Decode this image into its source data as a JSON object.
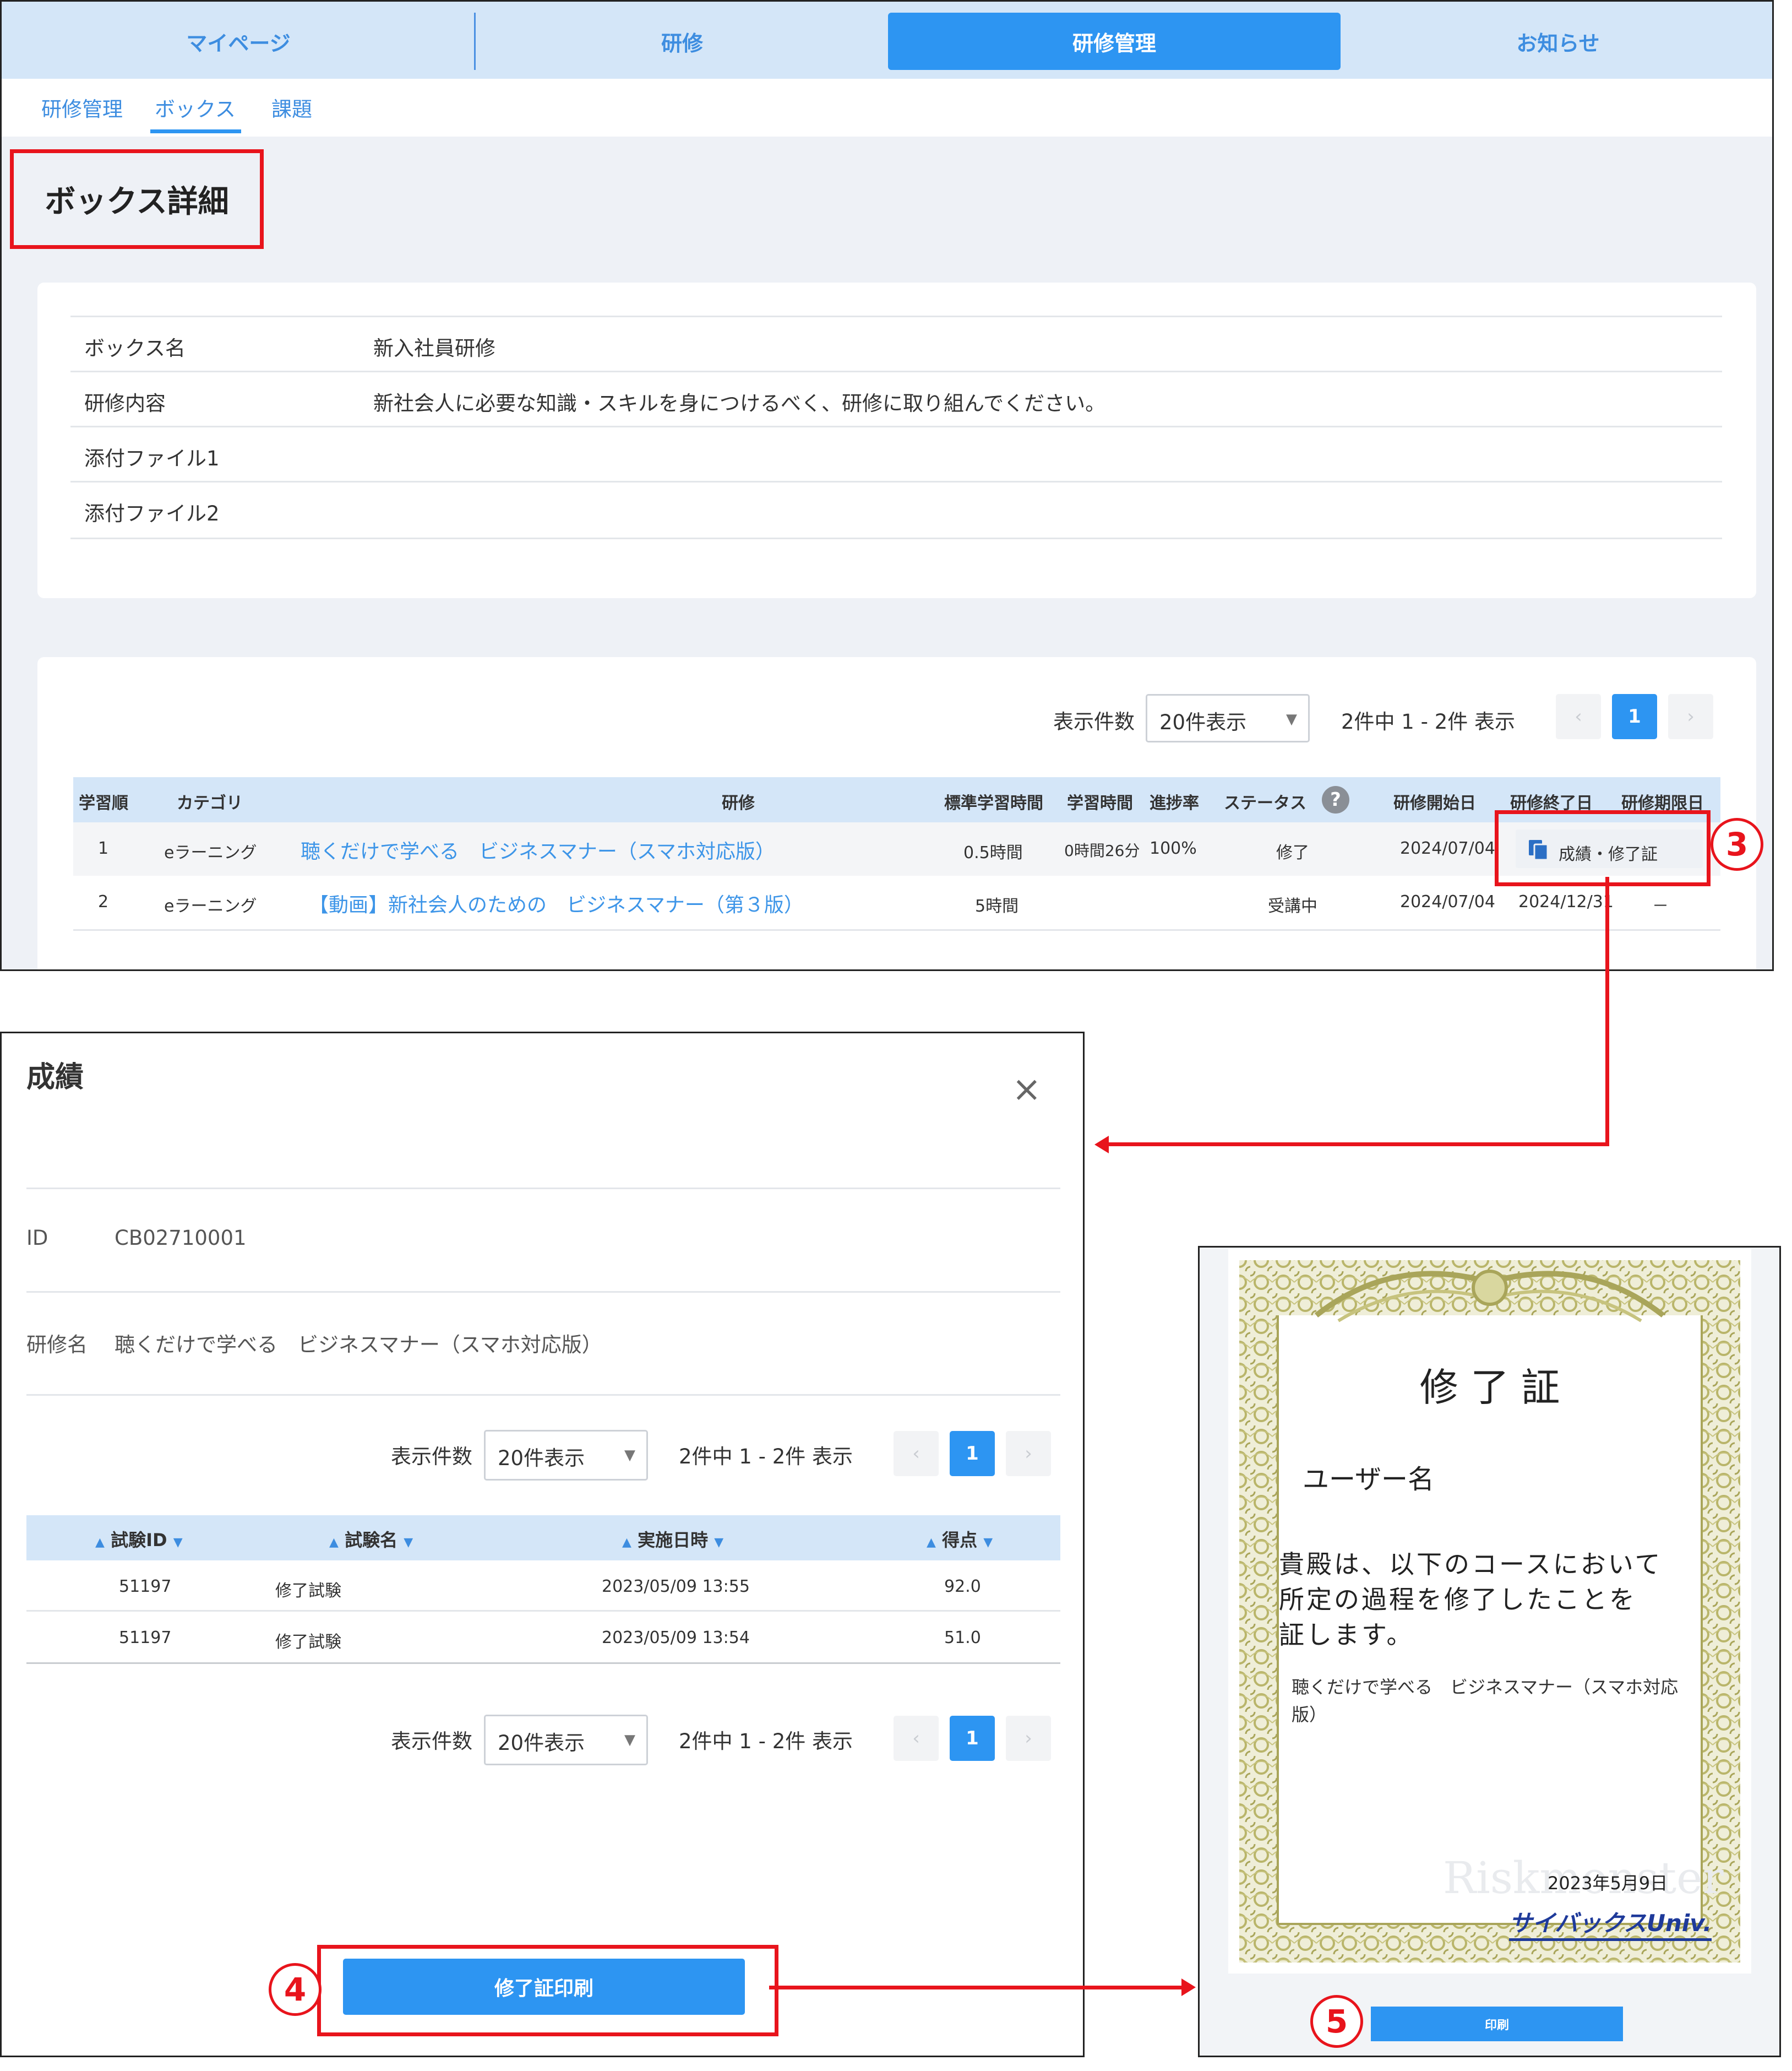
{
  "nav": {
    "items": [
      "マイページ",
      "研修",
      "研修管理",
      "お知らせ"
    ]
  },
  "subnav": {
    "items": [
      "研修管理",
      "ボックス",
      "課題"
    ]
  },
  "page": {
    "title": "ボックス詳細"
  },
  "details": [
    {
      "key": "ボックス名",
      "value": "新入社員研修"
    },
    {
      "key": "研修内容",
      "value": "新社会人に必要な知識・スキルを身につけるべく、研修に取り組んでください。"
    },
    {
      "key": "添付ファイル1",
      "value": ""
    },
    {
      "key": "添付ファイル2",
      "value": ""
    }
  ],
  "list": {
    "per_page_label": "表示件数",
    "per_page_value": "20件表示",
    "count_text": "2件中 1 - 2件 表示",
    "prev": "‹",
    "page": "1",
    "next": "›",
    "columns": [
      "学習順",
      "カテゴリ",
      "研修",
      "標準学習時間",
      "学習時間",
      "進捗率",
      "ステータス",
      "研修開始日",
      "研修終了日",
      "研修期限日"
    ],
    "help_icon": "?",
    "rows": [
      {
        "order": "1",
        "category": "eラーニング",
        "title": "聴くだけで学べる　ビジネスマナー（スマホ対応版）",
        "std_time": "0.5時間",
        "study_time": "0時間26分",
        "progress": "100%",
        "status": "修了",
        "start": "2024/07/04",
        "end": "",
        "deadline": "",
        "action": "成績・修了証",
        "action_icon": "copy-document-icon"
      },
      {
        "order": "2",
        "category": "eラーニング",
        "title": "【動画】新社会人のための　ビジネスマナー（第３版）",
        "std_time": "5時間",
        "study_time": "",
        "progress": "",
        "status": "受講中",
        "start": "2024/07/04",
        "end": "2024/12/31",
        "deadline": "－",
        "action": ""
      }
    ]
  },
  "callouts": {
    "three": "3",
    "four": "4",
    "five": "5"
  },
  "modal": {
    "title": "成績",
    "close": "×",
    "id_label": "ID",
    "id_value": "CB02710001",
    "course_label": "研修名",
    "course_value": "聴くだけで学べる　ビジネスマナー（スマホ対応版）",
    "per_page_label": "表示件数",
    "per_page_value": "20件表示",
    "count_text": "2件中 1 - 2件 表示",
    "page": "1",
    "prev": "‹",
    "next": "›",
    "columns": [
      "試験ID",
      "試験名",
      "実施日時",
      "得点"
    ],
    "rows": [
      {
        "id": "51197",
        "name": "修了試験",
        "date": "2023/05/09 13:55",
        "score": "92.0"
      },
      {
        "id": "51197",
        "name": "修了試験",
        "date": "2023/05/09 13:54",
        "score": "51.0"
      }
    ],
    "print_button": "修了証印刷"
  },
  "certificate": {
    "title": "修 了 証",
    "user": "ユーザー名",
    "body_line1": "貴殿は、以下のコースにおいて",
    "body_line2": "所定の過程を修了したことを",
    "body_line3": "証します。",
    "course_line1": "聴くだけで学べる　ビジネスマナー（スマホ対応",
    "course_line2": "版）",
    "watermark": "Riskmonster",
    "date": "2023年5月9日",
    "logo": "サイバックスUniv.",
    "print_button": "印刷"
  },
  "colors": {
    "accent": "#2d95f2",
    "nav_bg": "#d4e6f8",
    "callout_red": "#e8141c",
    "border_gold": "#b9b56a"
  }
}
